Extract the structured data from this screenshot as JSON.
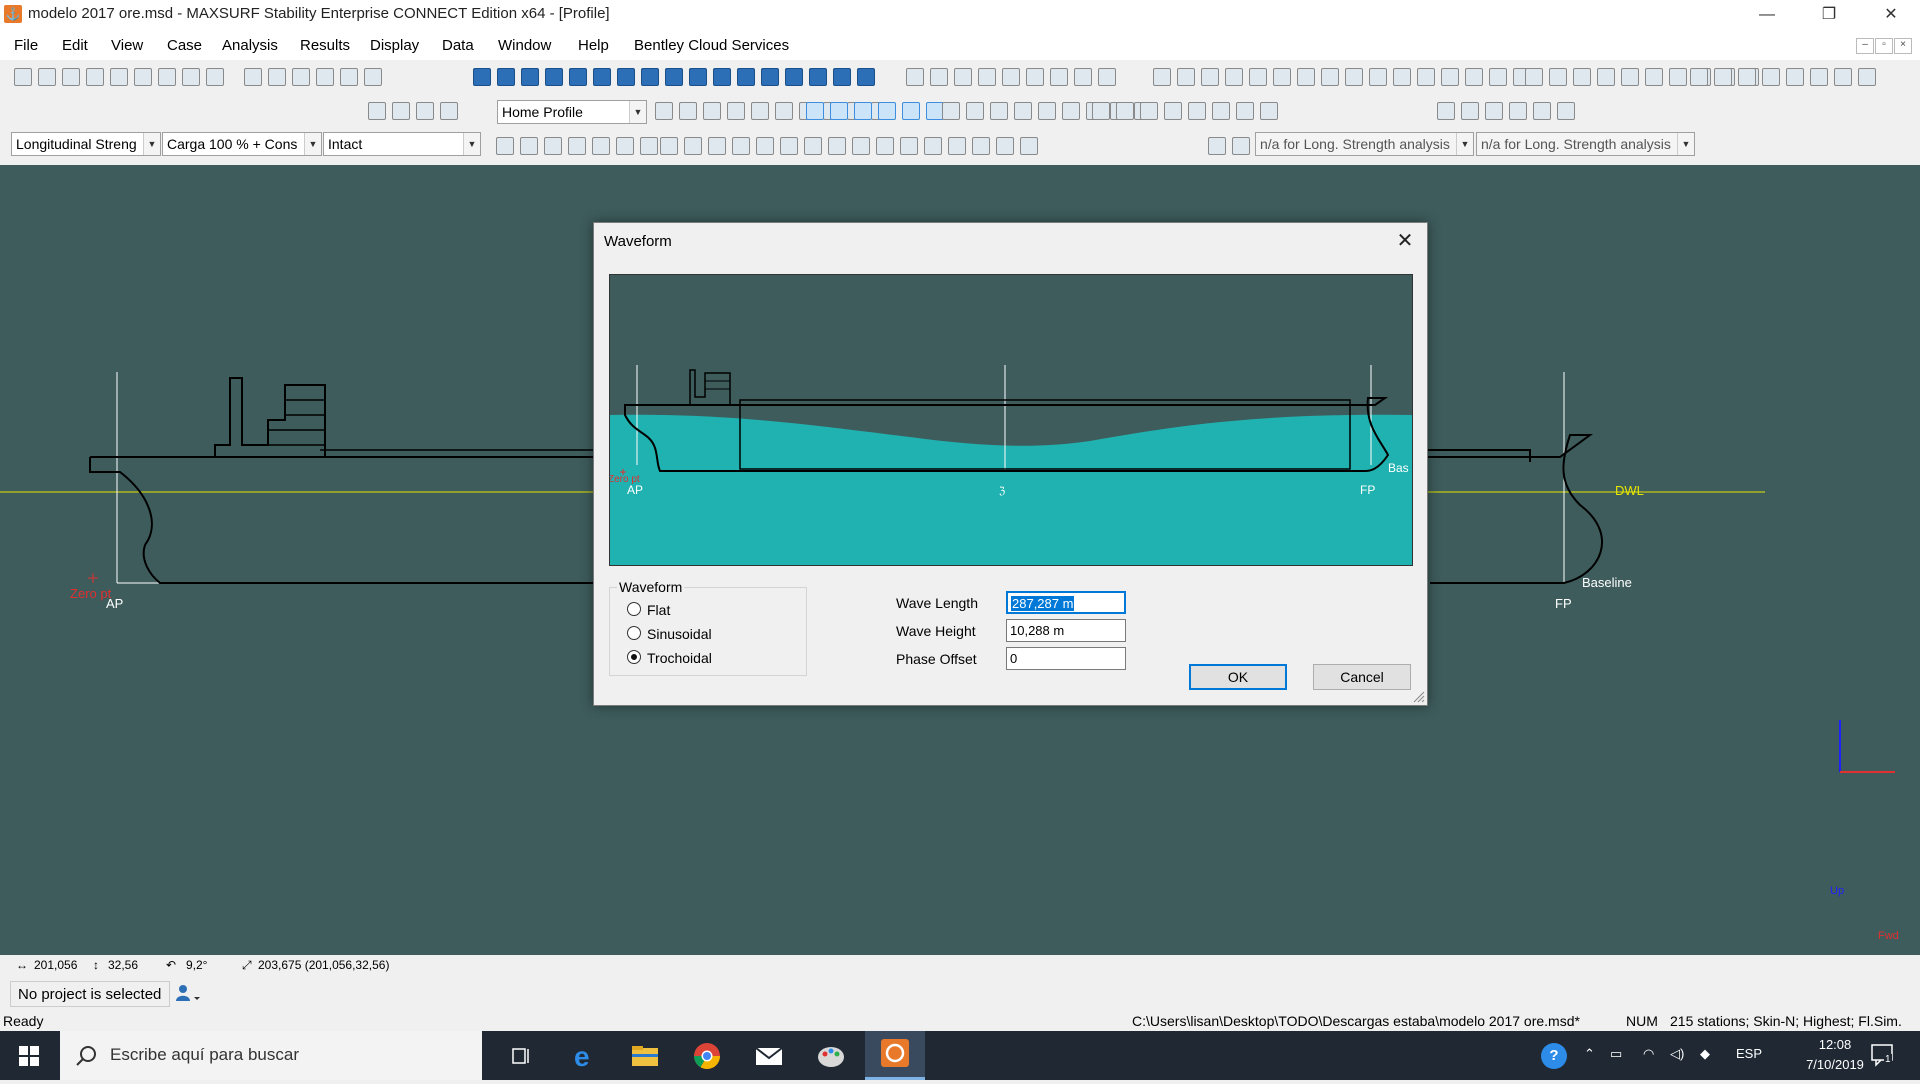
{
  "window": {
    "title": "modelo 2017 ore.msd - MAXSURF Stability Enterprise CONNECT Edition x64 - [Profile]",
    "minimize": "—",
    "restore": "❐",
    "close": "✕"
  },
  "menu": [
    "File",
    "Edit",
    "View",
    "Case",
    "Analysis",
    "Results",
    "Display",
    "Data",
    "Window",
    "Help",
    "Bentley Cloud Services"
  ],
  "mdi_controls": [
    "–",
    "▫",
    "×"
  ],
  "toolbars": {
    "view_combo": "Home Profile",
    "analysis_combo": "Longitudinal Streng",
    "loadcase_combo": "Carga 100 % + Cons",
    "damage_combo": "Intact",
    "na_combo_1": "n/a for Long. Strength analysis",
    "na_combo_2": "n/a for Long. Strength analysis"
  },
  "canvas": {
    "labels": {
      "ap": "AP",
      "fp": "FP",
      "dwl": "DWL",
      "baseline": "Baseline",
      "zero_pt": "Zero pt",
      "axis_up": "Up",
      "axis_fwd": "Fwd"
    },
    "colors": {
      "background": "#3e5c5c",
      "waterline": "#e6e600",
      "zero": "#e03030",
      "axis": "#2020ff"
    }
  },
  "dialog": {
    "title": "Waveform",
    "close": "✕",
    "preview_labels": {
      "ap": "AP",
      "fp": "FP",
      "mid": "ℨ",
      "bas": "Bas",
      "zero": "Zero pt"
    },
    "preview_colors": {
      "water": "#20b2b0",
      "hull": "#000000"
    },
    "waveform_group": {
      "label": "Waveform",
      "options": [
        "Flat",
        "Sinusoidal",
        "Trochoidal"
      ],
      "selected": "Trochoidal"
    },
    "fields": {
      "wave_length": {
        "label": "Wave Length",
        "value": "287,287 m"
      },
      "wave_height": {
        "label": "Wave Height",
        "value": "10,288 m"
      },
      "phase_offset": {
        "label": "Phase Offset",
        "value": "0"
      }
    },
    "ok": "OK",
    "cancel": "Cancel"
  },
  "coords": {
    "x": "201,056",
    "z": "32,56",
    "angle": "9,2°",
    "dist": "203,675 (201,056,32,56)"
  },
  "project": {
    "text": "No project is selected"
  },
  "status": {
    "ready": "Ready",
    "path": "C:\\Users\\lisan\\Desktop\\TODO\\Descargas estaba\\modelo 2017 ore.msd*",
    "num": "NUM",
    "info": "215 stations; Skin-N; Highest; Fl.Sim."
  },
  "taskbar": {
    "search_placeholder": "Escribe aquí para buscar",
    "lang": "ESP",
    "time": "12:08",
    "date": "7/10/2019",
    "notifications": "1"
  }
}
